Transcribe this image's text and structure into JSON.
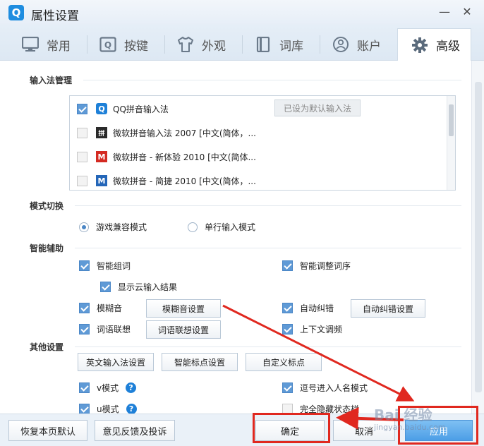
{
  "window": {
    "title": "属性设置",
    "logo_letter": "Q",
    "minimize": "—",
    "close": "✕"
  },
  "tabs": [
    {
      "label": "常用",
      "icon": "monitor-icon"
    },
    {
      "label": "按键",
      "icon": "key-icon"
    },
    {
      "label": "外观",
      "icon": "shirt-icon"
    },
    {
      "label": "词库",
      "icon": "book-icon"
    },
    {
      "label": "账户",
      "icon": "user-icon"
    },
    {
      "label": "高级",
      "icon": "gear-icon",
      "active": true
    }
  ],
  "sections": {
    "input_manager": "输入法管理",
    "mode_switch": "模式切换",
    "smart_assist": "智能辅助",
    "other_settings": "其他设置"
  },
  "ime_list": [
    {
      "name": "QQ拼音输入法",
      "checked": true,
      "icon_letter": "Q",
      "icon_color": "#1e80d8"
    },
    {
      "name": "微软拼音输入法 2007 [中文(简体，...",
      "checked": false,
      "icon_letter": "拼",
      "icon_color": "#2a2a2a"
    },
    {
      "name": "微软拼音 - 新体验 2010 [中文(简体...",
      "checked": false,
      "icon_letter": "M",
      "icon_color": "#d42a22"
    },
    {
      "name": "微软拼音 - 简捷 2010 [中文(简体，...",
      "checked": false,
      "icon_letter": "M",
      "icon_color": "#2466b8"
    }
  ],
  "set_default_button": "已设为默认输入法",
  "mode": {
    "game_compat": "游戏兼容模式",
    "single_line": "单行输入模式",
    "selected": "game_compat"
  },
  "assist": {
    "smart_phrase": "智能组词",
    "smart_adjust": "智能调整词序",
    "show_cloud": "显示云输入结果",
    "fuzzy": "模糊音",
    "fuzzy_settings": "模糊音设置",
    "auto_correct": "自动纠错",
    "auto_correct_settings": "自动纠错设置",
    "word_assoc": "词语联想",
    "word_assoc_settings": "词语联想设置",
    "context_adjust": "上下文调频"
  },
  "other": {
    "en_ime_settings": "英文输入法设置",
    "smart_punct_settings": "智能标点设置",
    "custom_punct": "自定义标点",
    "v_mode": "v模式",
    "comma_name": "逗号进入人名模式",
    "u_mode": "u模式",
    "hide_status": "完全隐藏状态栏"
  },
  "footer": {
    "restore": "恢复本页默认",
    "feedback": "意见反馈及投诉",
    "ok": "确定",
    "cancel": "取消",
    "apply": "应用"
  },
  "watermark": {
    "text": "Bai 经验",
    "url": "jingyan.baidu.com"
  },
  "annotation_color": "#e0281f"
}
